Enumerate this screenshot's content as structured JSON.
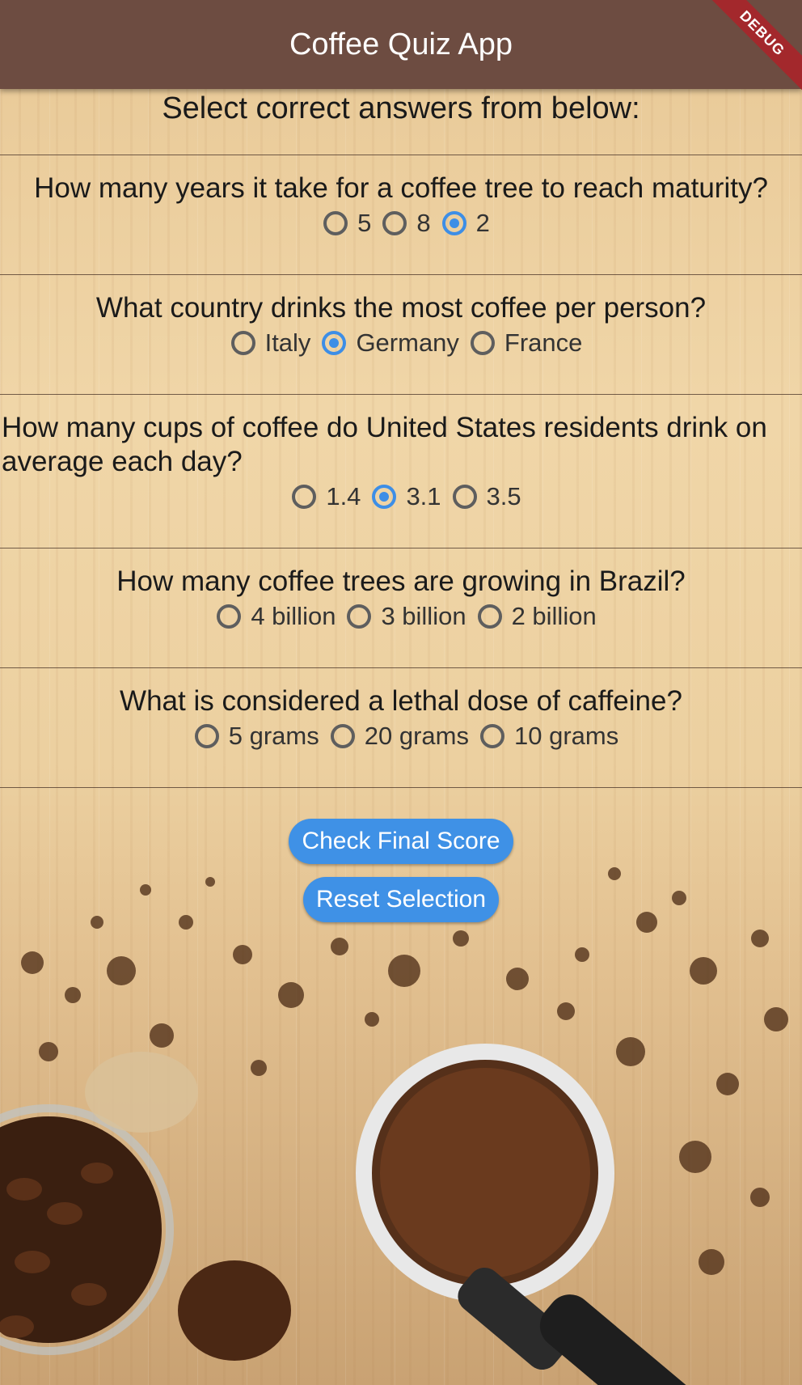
{
  "appbar": {
    "title": "Coffee Quiz App",
    "debug_label": "DEBUG"
  },
  "heading": "Select correct answers from below:",
  "questions": [
    {
      "text": "How many years it take for a coffee tree to reach maturity?",
      "options": [
        "5",
        "8",
        "2"
      ],
      "selected": 2
    },
    {
      "text": "What country drinks the most coffee per person?",
      "options": [
        "Italy",
        "Germany",
        "France"
      ],
      "selected": 1
    },
    {
      "text": "How many cups of coffee do United States residents drink on average each day?",
      "options": [
        "1.4",
        "3.1",
        "3.5"
      ],
      "selected": 1
    },
    {
      "text": "How many coffee trees are growing in Brazil?",
      "options": [
        "4 billion",
        "3 billion",
        "2 billion"
      ],
      "selected": null
    },
    {
      "text": "What is considered a lethal dose of caffeine?",
      "options": [
        "5 grams",
        "20 grams",
        "10 grams"
      ],
      "selected": null
    }
  ],
  "buttons": {
    "check": "Check Final Score",
    "reset": "Reset Selection"
  },
  "colors": {
    "appbar": "#6d4c41",
    "accent": "#3f91e6",
    "debug": "#a3282c"
  }
}
